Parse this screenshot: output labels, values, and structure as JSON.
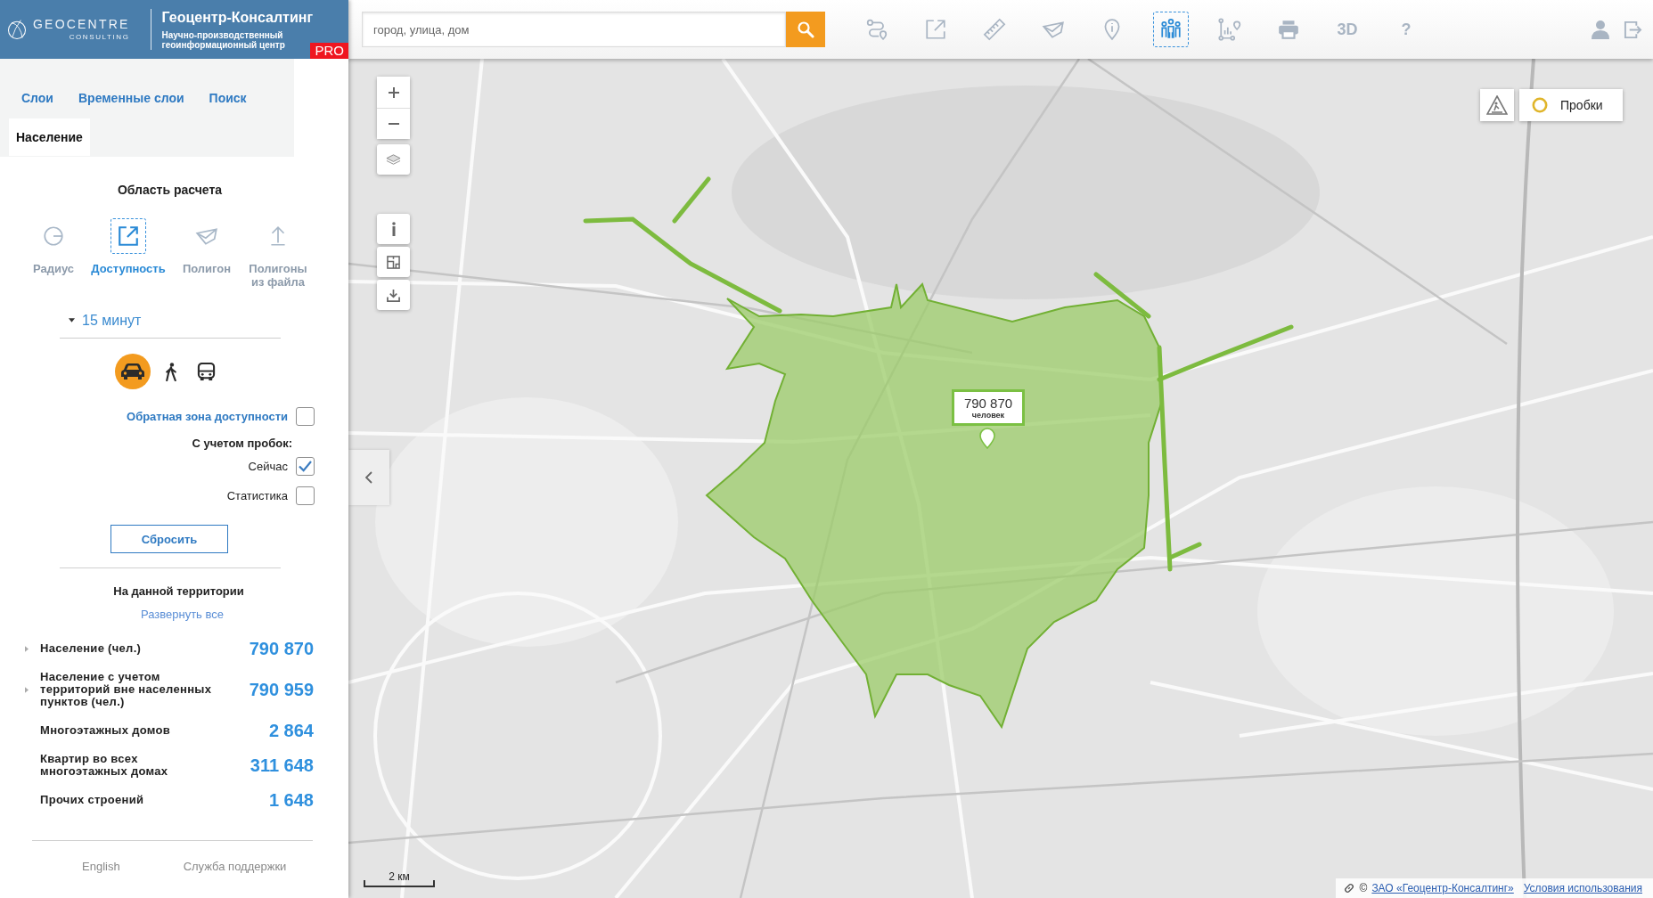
{
  "header": {
    "logo": {
      "name": "GEOCENTRE",
      "tagline": "CONSULTING"
    },
    "title": "Геоцентр-Консалтинг",
    "subtitle": "Научно-производственный\nгеоинформационный центр",
    "badge": "PRO"
  },
  "search": {
    "placeholder": "город, улица, дом"
  },
  "toolbar": {
    "items": [
      {
        "kind": "route",
        "selected": false
      },
      {
        "kind": "area",
        "selected": false
      },
      {
        "kind": "ruler",
        "selected": false
      },
      {
        "kind": "polygon",
        "selected": false
      },
      {
        "kind": "info",
        "selected": false
      },
      {
        "kind": "population",
        "selected": true
      },
      {
        "kind": "stats",
        "selected": false
      },
      {
        "kind": "print",
        "selected": false
      },
      {
        "kind": "text",
        "label": "3D",
        "selected": false
      },
      {
        "kind": "text",
        "label": "?",
        "selected": false
      }
    ]
  },
  "sidebar": {
    "tabs": [
      {
        "label": "Слои",
        "selected": false
      },
      {
        "label": "Временные слои",
        "selected": false
      },
      {
        "label": "Поиск",
        "selected": false
      },
      {
        "label": "Население",
        "selected": true
      }
    ],
    "area_title": "Область расчета",
    "modes": [
      {
        "kind": "radius",
        "label": "Радиус",
        "selected": false
      },
      {
        "kind": "accessibility",
        "label": "Доступность",
        "selected": true
      },
      {
        "kind": "polygon",
        "label": "Полигон",
        "selected": false
      },
      {
        "kind": "upload",
        "label": "Полигоны\nиз файла",
        "selected": false
      }
    ],
    "time": {
      "value": "15 минут"
    },
    "transport": [
      {
        "kind": "car",
        "selected": true
      },
      {
        "kind": "walk",
        "selected": false
      },
      {
        "kind": "bus",
        "selected": false
      }
    ],
    "reverse_zone": {
      "label": "Обратная зона доступности",
      "checked": false
    },
    "traffic": {
      "title": "С учетом пробок:",
      "options": [
        {
          "label": "Сейчас",
          "checked": true
        },
        {
          "label": "Статистика",
          "checked": false
        }
      ]
    },
    "reset_button": "Сбросить",
    "results": {
      "title": "На данной территории",
      "expand_all": "Развернуть все",
      "rows": [
        {
          "label": "Население (чел.)",
          "value": "790 870",
          "expandable": true
        },
        {
          "label": "Население с учетом\nтерриторий вне населенных\nпунктов (чел.)",
          "value": "790 959",
          "expandable": true
        },
        {
          "label": "Многоэтажных домов",
          "value": "2 864",
          "expandable": false
        },
        {
          "label": "Квартир во всех\nмногоэтажных домах",
          "value": "311 648",
          "expandable": false
        },
        {
          "label": "Прочих строений",
          "value": "1 648",
          "expandable": false
        }
      ]
    },
    "footer": [
      "English",
      "Служба поддержки"
    ]
  },
  "map": {
    "traffic_button": {
      "label": "Пробки",
      "on": false
    },
    "marker_label": {
      "value": "790 870",
      "unit": "человек"
    },
    "scale": "2 км",
    "attribution": {
      "copyright": "©",
      "owner": "ЗАО «Геоцентр-Консалтинг»",
      "terms": "Условия использования"
    }
  }
}
